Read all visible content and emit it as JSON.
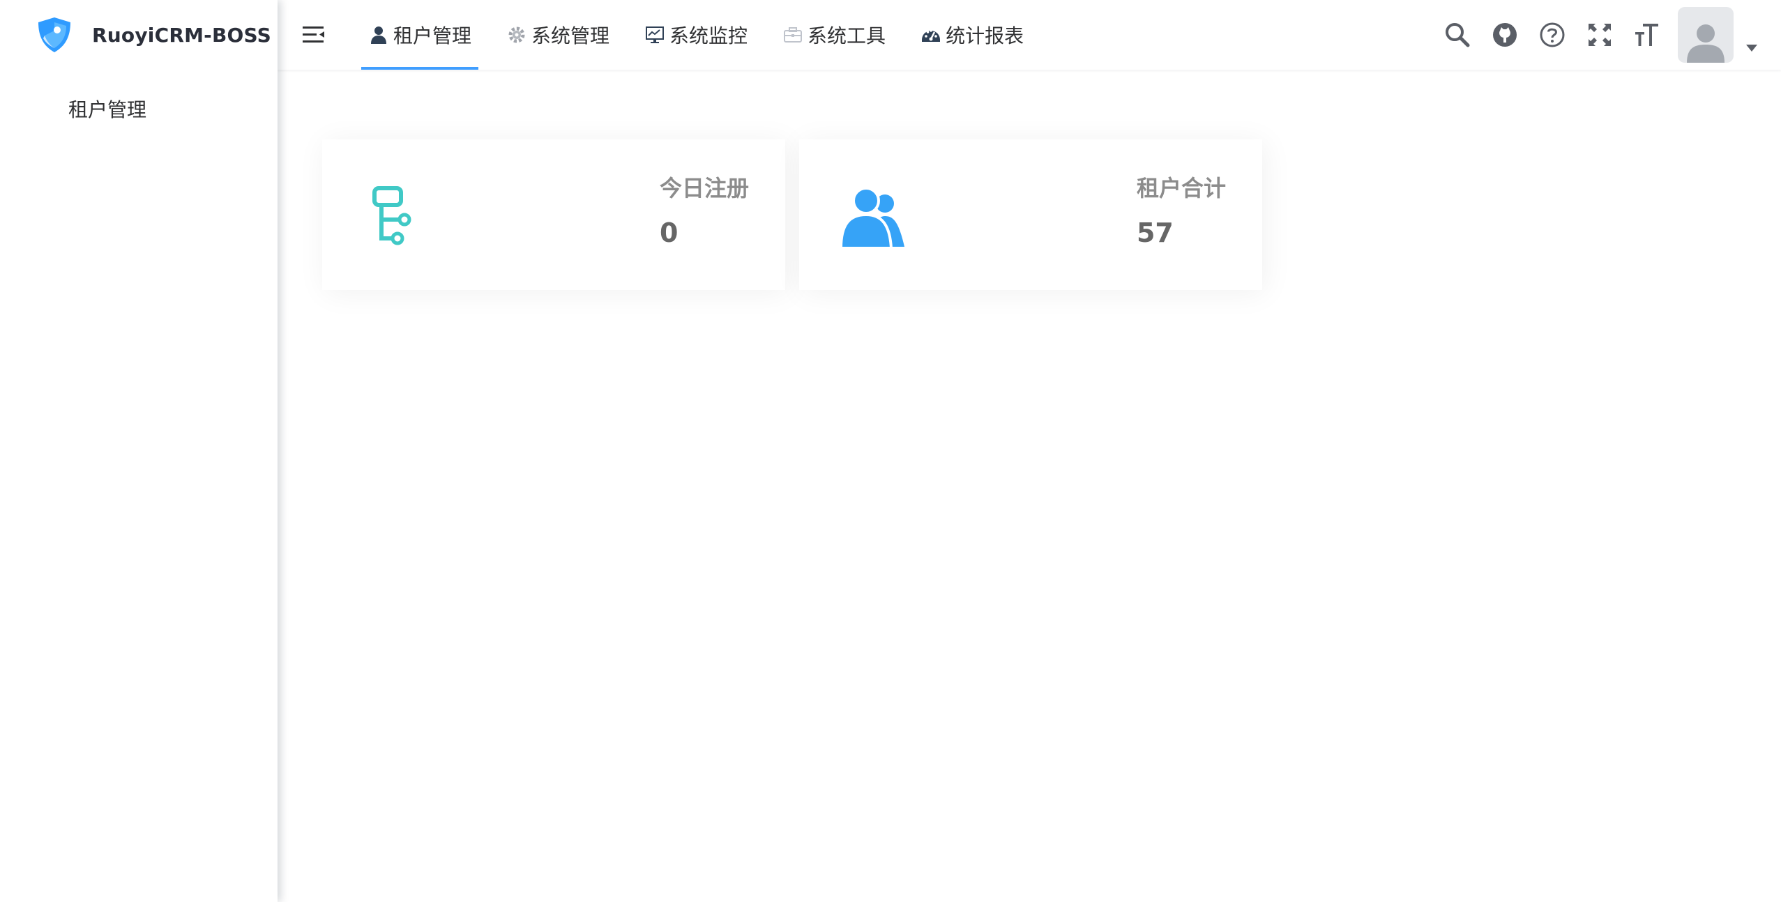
{
  "sidebar": {
    "logo_title": "RuoyiCRM-BOSS",
    "items": [
      {
        "label": "租户管理"
      }
    ]
  },
  "navbar": {
    "topmenu": [
      {
        "label": "租户管理",
        "icon": "user-icon",
        "active": true
      },
      {
        "label": "系统管理",
        "icon": "gear-icon",
        "active": false
      },
      {
        "label": "系统监控",
        "icon": "monitor-icon",
        "active": false
      },
      {
        "label": "系统工具",
        "icon": "toolbox-icon",
        "active": false
      },
      {
        "label": "统计报表",
        "icon": "dashboard-gauge-icon",
        "active": false
      }
    ],
    "right_tools": [
      "search-icon",
      "github-icon",
      "help-question-icon",
      "fullscreen-icon",
      "font-size-icon",
      "avatar",
      "chevron-down-icon"
    ]
  },
  "cards": [
    {
      "label": "今日注册",
      "value": "0",
      "icon": "tree-icon",
      "color": "#40c9c6"
    },
    {
      "label": "租户合计",
      "value": "57",
      "icon": "peoples-icon",
      "color": "#36a3f7"
    }
  ],
  "colors": {
    "accent": "#409eff",
    "text": "#303133",
    "card_label": "#8c8c8c",
    "card_value": "#666666"
  }
}
